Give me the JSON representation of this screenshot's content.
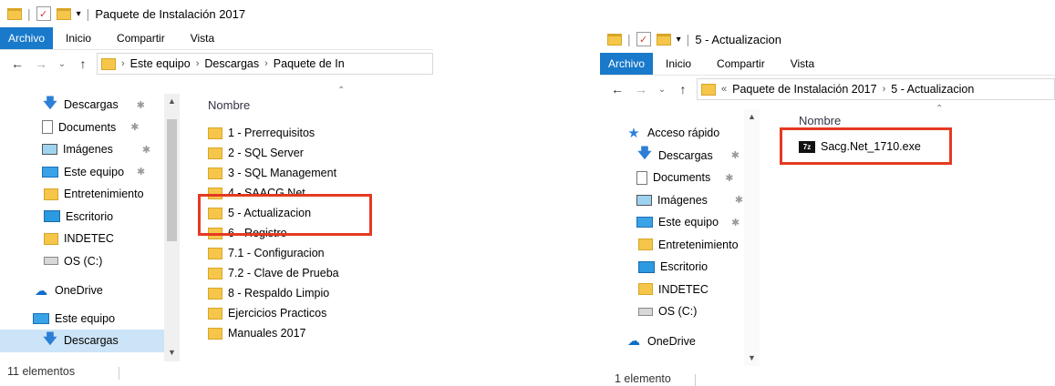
{
  "left": {
    "title": "Paquete de Instalación 2017",
    "ribbon_tabs": [
      "Archivo",
      "Inicio",
      "Compartir",
      "Vista"
    ],
    "address": [
      "Este equipo",
      "Descargas",
      "Paquete de In"
    ],
    "nav_items": [
      {
        "label": "Descargas",
        "icon": "download-arrow-icon",
        "pinned": true
      },
      {
        "label": "Documents",
        "icon": "documents-icon",
        "pinned": true
      },
      {
        "label": "Imágenes",
        "icon": "pictures-icon",
        "pinned": true
      },
      {
        "label": "Este equipo",
        "icon": "computer-icon",
        "pinned": true
      },
      {
        "label": "Entretenimiento",
        "icon": "folder-icon",
        "pinned": false
      },
      {
        "label": "Escritorio",
        "icon": "desktop-icon",
        "pinned": false
      },
      {
        "label": "INDETEC",
        "icon": "folder-icon",
        "pinned": false
      },
      {
        "label": "OS (C:)",
        "icon": "drive-icon",
        "pinned": false
      },
      {
        "label": "OneDrive",
        "icon": "onedrive-icon",
        "pinned": false
      },
      {
        "label": "Este equipo",
        "icon": "computer-icon",
        "pinned": false
      },
      {
        "label": "Descargas",
        "icon": "download-arrow-icon",
        "pinned": false,
        "selected": true
      }
    ],
    "column_header": "Nombre",
    "files": [
      "1 - Prerrequisitos",
      "2 - SQL Server",
      "3 - SQL Management",
      "4 - SAACG.Net",
      "5 - Actualizacion",
      "6 - Registro",
      "7.1 - Configuracion",
      "7.2 - Clave de Prueba",
      "8 - Respaldo Limpio",
      "Ejercicios Practicos",
      "Manuales 2017"
    ],
    "status": "11 elementos"
  },
  "right": {
    "title": "5 - Actualizacion",
    "ribbon_tabs": [
      "Archivo",
      "Inicio",
      "Compartir",
      "Vista"
    ],
    "address_prefix": "«",
    "address": [
      "Paquete de Instalación 2017",
      "5 - Actualizacion"
    ],
    "nav_items": [
      {
        "label": "Acceso rápido",
        "icon": "star-icon",
        "pinned": false
      },
      {
        "label": "Descargas",
        "icon": "download-arrow-icon",
        "pinned": true
      },
      {
        "label": "Documents",
        "icon": "documents-icon",
        "pinned": true
      },
      {
        "label": "Imágenes",
        "icon": "pictures-icon",
        "pinned": true
      },
      {
        "label": "Este equipo",
        "icon": "computer-icon",
        "pinned": true
      },
      {
        "label": "Entretenimiento",
        "icon": "folder-icon",
        "pinned": false
      },
      {
        "label": "Escritorio",
        "icon": "desktop-icon",
        "pinned": false
      },
      {
        "label": "INDETEC",
        "icon": "folder-icon",
        "pinned": false
      },
      {
        "label": "OS (C:)",
        "icon": "drive-icon",
        "pinned": false
      },
      {
        "label": "OneDrive",
        "icon": "onedrive-icon",
        "pinned": false
      }
    ],
    "column_header": "Nombre",
    "files": [
      {
        "label": "Sacg.Net_1710.exe",
        "icon": "7z-archive-icon",
        "icon_text": "7z"
      }
    ],
    "status": "1 elemento"
  },
  "colors": {
    "accent": "#1979ca",
    "highlight": "#e53a21",
    "folder": "#f5c64a"
  }
}
